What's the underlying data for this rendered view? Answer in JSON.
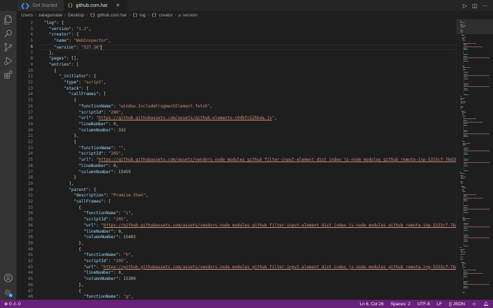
{
  "tabs": [
    {
      "label": "Get Started",
      "icon": "vscode-logo-icon",
      "active": false
    },
    {
      "label": "github.com.har",
      "icon": "json-braces-icon",
      "active": true,
      "close": "✕"
    }
  ],
  "breadcrumb": [
    "Users",
    "salagumalai",
    "Desktop",
    "github.com.har",
    "log",
    "creator",
    "version"
  ],
  "editor": {
    "current_line": 6,
    "lines": [
      {
        "n": 2,
        "segs": [
          [
            "p",
            "  \""
          ],
          [
            "k",
            "log"
          ],
          [
            "p",
            "\": {"
          ]
        ]
      },
      {
        "n": 3,
        "segs": [
          [
            "p",
            "    \""
          ],
          [
            "k",
            "version"
          ],
          [
            "p",
            "\": "
          ],
          [
            "s",
            "\"1.2\""
          ],
          [
            "p",
            ","
          ]
        ]
      },
      {
        "n": 4,
        "segs": [
          [
            "p",
            "    \""
          ],
          [
            "k",
            "creator"
          ],
          [
            "p",
            "\": {"
          ]
        ]
      },
      {
        "n": 5,
        "segs": [
          [
            "p",
            "      \""
          ],
          [
            "k",
            "name"
          ],
          [
            "p",
            "\": "
          ],
          [
            "s",
            "\"WebInspector\""
          ],
          [
            "p",
            ","
          ]
        ]
      },
      {
        "n": 6,
        "segs": [
          [
            "p",
            "      \""
          ],
          [
            "k",
            "version"
          ],
          [
            "p",
            "\": "
          ],
          [
            "s",
            "\"537.36\""
          ]
        ]
      },
      {
        "n": 7,
        "segs": [
          [
            "p",
            "    },"
          ]
        ]
      },
      {
        "n": 8,
        "segs": [
          [
            "p",
            "    \""
          ],
          [
            "k",
            "pages"
          ],
          [
            "p",
            "\": [],"
          ]
        ]
      },
      {
        "n": 9,
        "segs": [
          [
            "p",
            "    \""
          ],
          [
            "k",
            "entries"
          ],
          [
            "p",
            "\": ["
          ]
        ]
      },
      {
        "n": 10,
        "segs": [
          [
            "p",
            "      {"
          ]
        ]
      },
      {
        "n": 11,
        "segs": [
          [
            "p",
            "        \""
          ],
          [
            "k",
            "_initiator"
          ],
          [
            "p",
            "\": {"
          ]
        ]
      },
      {
        "n": 12,
        "segs": [
          [
            "p",
            "          \""
          ],
          [
            "k",
            "type"
          ],
          [
            "p",
            "\": "
          ],
          [
            "s",
            "\"script\""
          ],
          [
            "p",
            ","
          ]
        ]
      },
      {
        "n": 13,
        "segs": [
          [
            "p",
            "          \""
          ],
          [
            "k",
            "stack"
          ],
          [
            "p",
            "\": {"
          ]
        ]
      },
      {
        "n": 14,
        "segs": [
          [
            "p",
            "            \""
          ],
          [
            "k",
            "callFrames"
          ],
          [
            "p",
            "\": ["
          ]
        ]
      },
      {
        "n": 15,
        "segs": [
          [
            "p",
            "              {"
          ]
        ]
      },
      {
        "n": 16,
        "segs": [
          [
            "p",
            "                \""
          ],
          [
            "k",
            "functionName"
          ],
          [
            "p",
            "\": "
          ],
          [
            "s",
            "\"window.IncludeFragmentElement.fetch\""
          ],
          [
            "p",
            ","
          ]
        ]
      },
      {
        "n": 17,
        "segs": [
          [
            "p",
            "                \""
          ],
          [
            "k",
            "scriptId"
          ],
          [
            "p",
            "\": "
          ],
          [
            "s",
            "\"280\""
          ],
          [
            "p",
            ","
          ]
        ]
      },
      {
        "n": 18,
        "segs": [
          [
            "p",
            "                \""
          ],
          [
            "k",
            "url"
          ],
          [
            "p",
            "\": "
          ],
          [
            "s",
            "\""
          ],
          [
            "url",
            "https://github.githubassets.com/assets/github-elements-c0dbfc525bda.js"
          ],
          [
            "s",
            "\""
          ],
          [
            "p",
            ","
          ]
        ]
      },
      {
        "n": 19,
        "segs": [
          [
            "p",
            "                \""
          ],
          [
            "k",
            "lineNumber"
          ],
          [
            "p",
            "\": "
          ],
          [
            "n",
            "0"
          ],
          [
            "p",
            ","
          ]
        ]
      },
      {
        "n": 20,
        "segs": [
          [
            "p",
            "                \""
          ],
          [
            "k",
            "columnNumber"
          ],
          [
            "p",
            "\": "
          ],
          [
            "n",
            "332"
          ]
        ]
      },
      {
        "n": 21,
        "segs": [
          [
            "p",
            "              },"
          ]
        ]
      },
      {
        "n": 22,
        "segs": [
          [
            "p",
            "              {"
          ]
        ]
      },
      {
        "n": 23,
        "segs": [
          [
            "p",
            "                \""
          ],
          [
            "k",
            "functionName"
          ],
          [
            "p",
            "\": "
          ],
          [
            "s",
            "\"\""
          ],
          [
            "p",
            ","
          ]
        ]
      },
      {
        "n": 24,
        "segs": [
          [
            "p",
            "                \""
          ],
          [
            "k",
            "scriptId"
          ],
          [
            "p",
            "\": "
          ],
          [
            "s",
            "\"205\""
          ],
          [
            "p",
            ","
          ]
        ]
      },
      {
        "n": 25,
        "segs": [
          [
            "p",
            "                \""
          ],
          [
            "k",
            "url"
          ],
          [
            "p",
            "\": "
          ],
          [
            "s",
            "\""
          ],
          [
            "url",
            "https://github.githubassets.com/assets/vendors-node_modules_github_filter-input-element_dist_index_js-node_modules_github_remote-inp-5333cf-76d1bdf398"
          ]
        ]
      },
      {
        "n": 26,
        "segs": [
          [
            "p",
            "                \""
          ],
          [
            "k",
            "lineNumber"
          ],
          [
            "p",
            "\": "
          ],
          [
            "n",
            "0"
          ],
          [
            "p",
            ","
          ]
        ]
      },
      {
        "n": 27,
        "segs": [
          [
            "p",
            "                \""
          ],
          [
            "k",
            "columnNumber"
          ],
          [
            "p",
            "\": "
          ],
          [
            "n",
            "15455"
          ]
        ]
      },
      {
        "n": 28,
        "segs": [
          [
            "p",
            "              }"
          ]
        ]
      },
      {
        "n": 29,
        "segs": [
          [
            "p",
            "            ],"
          ]
        ]
      },
      {
        "n": 30,
        "segs": [
          [
            "p",
            "            \""
          ],
          [
            "k",
            "parent"
          ],
          [
            "p",
            "\": {"
          ]
        ]
      },
      {
        "n": 31,
        "segs": [
          [
            "p",
            "              \""
          ],
          [
            "k",
            "description"
          ],
          [
            "p",
            "\": "
          ],
          [
            "s",
            "\"Promise.then\""
          ],
          [
            "p",
            ","
          ]
        ]
      },
      {
        "n": 32,
        "segs": [
          [
            "p",
            "              \""
          ],
          [
            "k",
            "callFrames"
          ],
          [
            "p",
            "\": ["
          ]
        ]
      },
      {
        "n": 33,
        "segs": [
          [
            "p",
            "                {"
          ]
        ]
      },
      {
        "n": 34,
        "segs": [
          [
            "p",
            "                  \""
          ],
          [
            "k",
            "functionName"
          ],
          [
            "p",
            "\": "
          ],
          [
            "s",
            "\"i\""
          ],
          [
            "p",
            ","
          ]
        ]
      },
      {
        "n": 35,
        "segs": [
          [
            "p",
            "                  \""
          ],
          [
            "k",
            "scriptId"
          ],
          [
            "p",
            "\": "
          ],
          [
            "s",
            "\"205\""
          ],
          [
            "p",
            ","
          ]
        ]
      },
      {
        "n": 36,
        "segs": [
          [
            "p",
            "                  \""
          ],
          [
            "k",
            "url"
          ],
          [
            "p",
            "\": "
          ],
          [
            "s",
            "\""
          ],
          [
            "url",
            "https://github.githubassets.com/assets/vendors-node_modules_github_filter-input-element_dist_index_js-node_modules_github_remote-inp-5333cf-76d1bdf3"
          ]
        ]
      },
      {
        "n": 37,
        "segs": [
          [
            "p",
            "                  \""
          ],
          [
            "k",
            "lineNumber"
          ],
          [
            "p",
            "\": "
          ],
          [
            "n",
            "0"
          ],
          [
            "p",
            ","
          ]
        ]
      },
      {
        "n": 38,
        "segs": [
          [
            "p",
            "                  \""
          ],
          [
            "k",
            "columnNumber"
          ],
          [
            "p",
            "\": "
          ],
          [
            "n",
            "15403"
          ]
        ]
      },
      {
        "n": 39,
        "segs": [
          [
            "p",
            "                },"
          ]
        ]
      },
      {
        "n": 40,
        "segs": [
          [
            "p",
            "                {"
          ]
        ]
      },
      {
        "n": 41,
        "segs": [
          [
            "p",
            "                  \""
          ],
          [
            "k",
            "functionName"
          ],
          [
            "p",
            "\": "
          ],
          [
            "s",
            "\"h\""
          ],
          [
            "p",
            ","
          ]
        ]
      },
      {
        "n": 42,
        "segs": [
          [
            "p",
            "                  \""
          ],
          [
            "k",
            "scriptId"
          ],
          [
            "p",
            "\": "
          ],
          [
            "s",
            "\"205\""
          ],
          [
            "p",
            ","
          ]
        ]
      },
      {
        "n": 43,
        "segs": [
          [
            "p",
            "                  \""
          ],
          [
            "k",
            "url"
          ],
          [
            "p",
            "\": "
          ],
          [
            "s",
            "\""
          ],
          [
            "url",
            "https://github.githubassets.com/assets/vendors-node_modules_github_filter-input-element_dist_index_js-node_modules_github_remote-inp-5333cf-76d1bdf3"
          ]
        ]
      },
      {
        "n": 44,
        "segs": [
          [
            "p",
            "                  \""
          ],
          [
            "k",
            "lineNumber"
          ],
          [
            "p",
            "\": "
          ],
          [
            "n",
            "0"
          ],
          [
            "p",
            ","
          ]
        ]
      },
      {
        "n": 45,
        "segs": [
          [
            "p",
            "                  \""
          ],
          [
            "k",
            "columnNumber"
          ],
          [
            "p",
            "\": "
          ],
          [
            "n",
            "15309"
          ]
        ]
      },
      {
        "n": 46,
        "segs": [
          [
            "p",
            "                },"
          ]
        ]
      },
      {
        "n": 47,
        "segs": [
          [
            "p",
            "                {"
          ]
        ]
      },
      {
        "n": 48,
        "segs": [
          [
            "p",
            "                  \""
          ],
          [
            "k",
            "functionName"
          ],
          [
            "p",
            "\": "
          ],
          [
            "s",
            "\"g\""
          ],
          [
            "p",
            ","
          ]
        ]
      }
    ]
  },
  "status": {
    "errors": "0",
    "warnings": "0",
    "position": "Ln 6, Col 26",
    "spaces": "Spaces: 2",
    "encoding": "UTF-8",
    "eol": "LF",
    "language": "JSON"
  },
  "colors": {
    "statusbar": "#68217a",
    "activitybar": "#333333",
    "editor_bg": "#1e1e1e",
    "json_key": "#9cdcfe",
    "json_string": "#ce9178",
    "json_number": "#b5cea8"
  }
}
